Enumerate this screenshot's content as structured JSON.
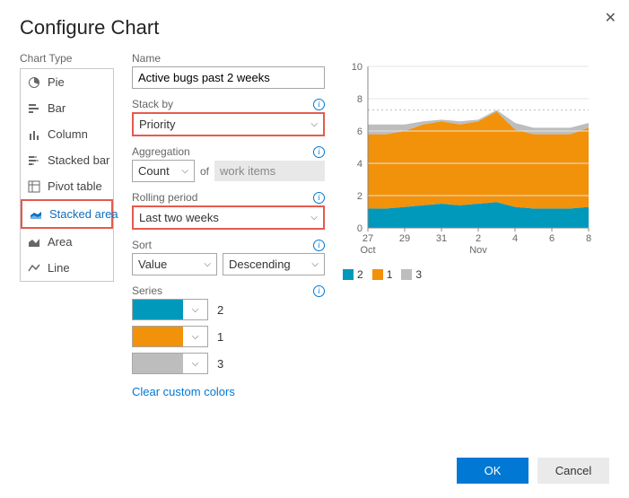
{
  "title": "Configure Chart",
  "chart_type_label": "Chart Type",
  "chart_types": [
    {
      "key": "pie",
      "label": "Pie"
    },
    {
      "key": "bar",
      "label": "Bar"
    },
    {
      "key": "column",
      "label": "Column"
    },
    {
      "key": "stacked-bar",
      "label": "Stacked bar"
    },
    {
      "key": "pivot-table",
      "label": "Pivot table"
    },
    {
      "key": "stacked-area",
      "label": "Stacked area",
      "selected": true
    },
    {
      "key": "area",
      "label": "Area"
    },
    {
      "key": "line",
      "label": "Line"
    }
  ],
  "form": {
    "name_label": "Name",
    "name_value": "Active bugs past 2 weeks",
    "stack_by_label": "Stack by",
    "stack_by_value": "Priority",
    "aggregation_label": "Aggregation",
    "aggregation_value": "Count",
    "aggregation_of": "of",
    "aggregation_target": "work items",
    "rolling_label": "Rolling period",
    "rolling_value": "Last two weeks",
    "sort_label": "Sort",
    "sort_field": "Value",
    "sort_dir": "Descending",
    "series_label": "Series",
    "series": [
      {
        "color": "#0099bc",
        "label": "2"
      },
      {
        "color": "#f2910a",
        "label": "1"
      },
      {
        "color": "#bdbdbd",
        "label": "3"
      }
    ],
    "clear_colors": "Clear custom colors"
  },
  "buttons": {
    "ok": "OK",
    "cancel": "Cancel"
  },
  "chart_data": {
    "type": "area",
    "stacked": true,
    "x": [
      "27",
      "28",
      "29",
      "30",
      "31",
      "1",
      "2",
      "3",
      "4",
      "5",
      "6",
      "7",
      "8"
    ],
    "x_ticks": [
      "27",
      "29",
      "31",
      "2",
      "4",
      "6",
      "8"
    ],
    "x_month_labels": {
      "27": "Oct",
      "2": "Nov"
    },
    "series": [
      {
        "name": "2",
        "color": "#0099bc",
        "values": [
          1.2,
          1.2,
          1.3,
          1.4,
          1.5,
          1.4,
          1.5,
          1.6,
          1.3,
          1.2,
          1.2,
          1.2,
          1.3
        ]
      },
      {
        "name": "1",
        "color": "#f2910a",
        "values": [
          4.6,
          4.6,
          4.7,
          5.0,
          5.1,
          5.0,
          5.1,
          5.6,
          4.8,
          4.6,
          4.6,
          4.6,
          4.9
        ]
      },
      {
        "name": "3",
        "color": "#bdbdbd",
        "values": [
          0.6,
          0.6,
          0.4,
          0.2,
          0.1,
          0.2,
          0.1,
          0.1,
          0.4,
          0.4,
          0.4,
          0.4,
          0.3
        ]
      }
    ],
    "ylim": [
      0,
      10
    ],
    "yticks": [
      0,
      2,
      4,
      6,
      8,
      10
    ],
    "threshold": 7.3
  }
}
